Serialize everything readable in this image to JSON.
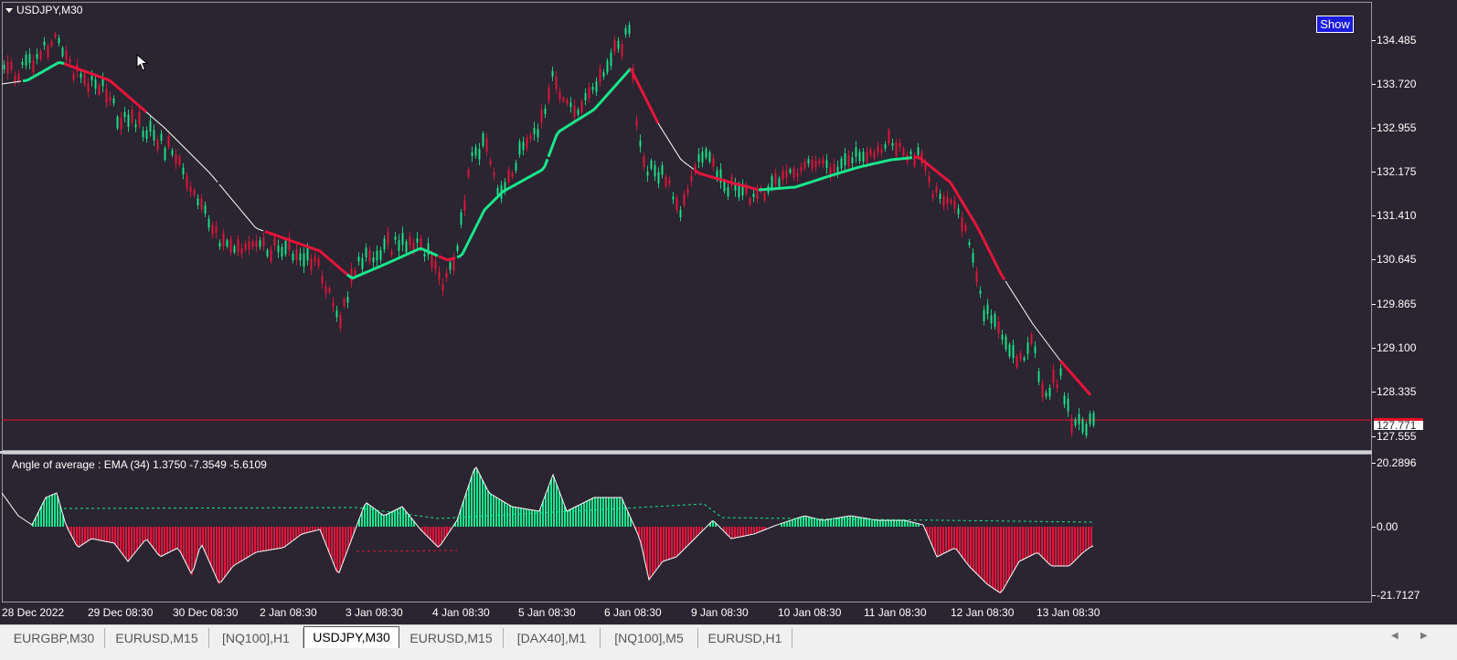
{
  "window": {
    "symbol_title": "USDJPY,M30",
    "show_button": "Show"
  },
  "indicator": {
    "title": "Angle of average : EMA (34)  1.3750 -7.3549 -5.6109"
  },
  "price_axis": {
    "labels": [
      "134.485",
      "133.720",
      "132.955",
      "132.175",
      "131.410",
      "130.645",
      "129.865",
      "129.100",
      "128.335",
      "127.555"
    ],
    "current_price": "127.771"
  },
  "indicator_axis": {
    "labels": [
      "20.2896",
      "0.00",
      "-21.7127"
    ]
  },
  "time_axis": {
    "labels": [
      "28 Dec 2022",
      "29 Dec 08:30",
      "30 Dec 08:30",
      "2 Jan 08:30",
      "3 Jan 08:30",
      "4 Jan 08:30",
      "5 Jan 08:30",
      "6 Jan 08:30",
      "9 Jan 08:30",
      "10 Jan 08:30",
      "11 Jan 08:30",
      "12 Jan 08:30",
      "13 Jan 08:30"
    ]
  },
  "tabs": [
    "EURGBP,M30",
    "EURUSD,M15",
    "[NQ100],H1",
    "USDJPY,M30",
    "EURUSD,M15",
    "[DAX40],M1",
    "[NQ100],M5",
    "EURUSD,H1"
  ],
  "active_tab": "USDJPY,M30",
  "colors": {
    "bull": "#19e68c",
    "bear": "#e8143c",
    "background": "#2a2530",
    "line": "#ffffff",
    "current_price_line": "#e8102a"
  },
  "icons": {
    "menu": "triangle-down-icon",
    "cursor": "mouse-pointer-icon",
    "scroll_left": "arrow-left-icon",
    "scroll_right": "arrow-right-icon"
  }
}
